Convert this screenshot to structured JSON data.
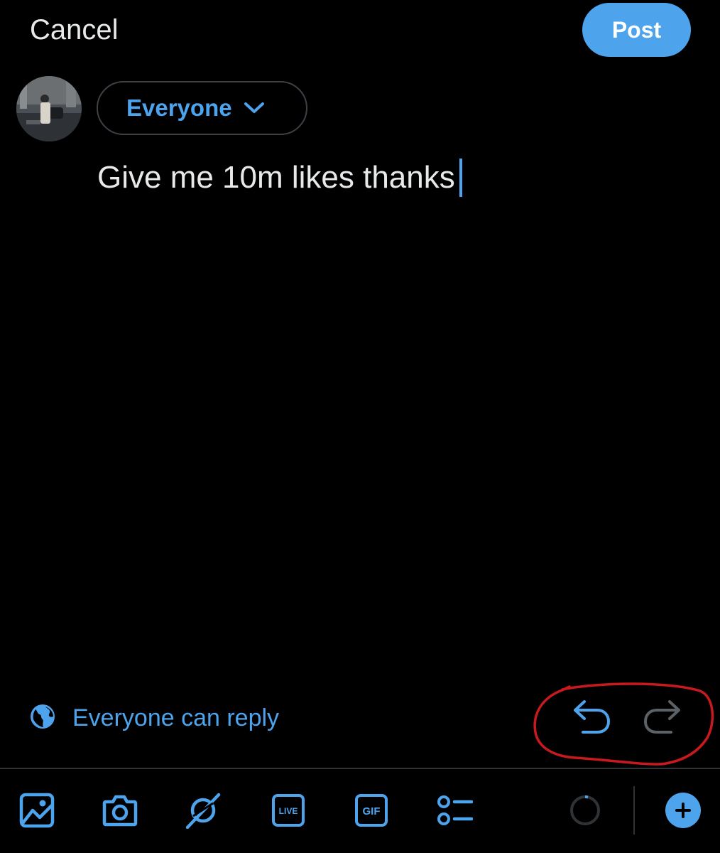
{
  "header": {
    "cancel_label": "Cancel",
    "post_label": "Post"
  },
  "composer": {
    "audience_label": "Everyone",
    "text": "Give me 10m likes thanks"
  },
  "reply_setting": {
    "label": "Everyone can reply",
    "icon": "globe-icon"
  },
  "actions": {
    "undo_icon": "undo-icon",
    "redo_icon": "redo-icon",
    "redo_enabled": false
  },
  "toolbar": {
    "items": [
      "image-icon",
      "camera-icon",
      "grok-icon",
      "live-icon",
      "gif-icon",
      "poll-icon"
    ],
    "live_text": "LIVE",
    "gif_text": "GIF"
  },
  "colors": {
    "accent": "#4da3ec",
    "background": "#000000",
    "text": "#e7e9ea",
    "muted": "#5c6166",
    "annotation": "#c8191e"
  }
}
